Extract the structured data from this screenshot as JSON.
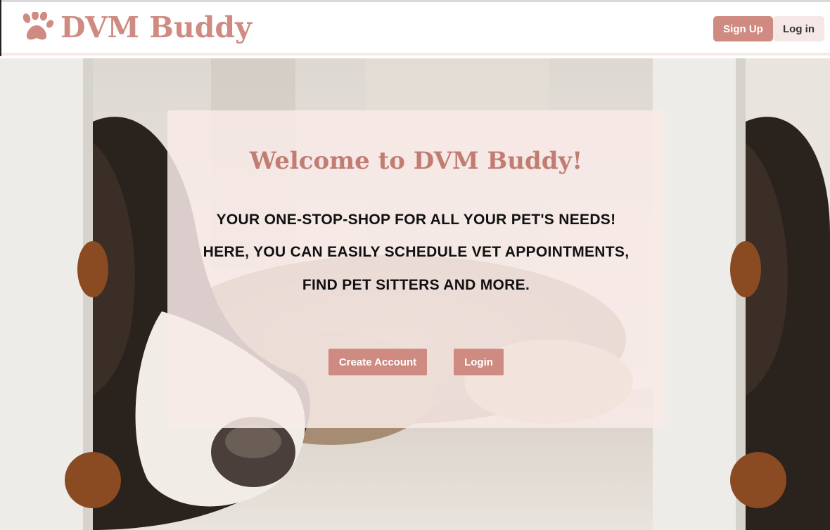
{
  "header": {
    "brand_name": "DVM Buddy",
    "brand_icon": "paw-icon",
    "signup_label": "Sign Up",
    "login_label": "Log in"
  },
  "hero": {
    "background_image": "dog-and-cat-lying-on-floor-photo"
  },
  "card": {
    "title": "Welcome to DVM Buddy!",
    "lines": [
      "YOUR ONE-STOP-SHOP FOR ALL YOUR PET'S NEEDS!",
      "HERE, YOU CAN EASILY SCHEDULE VET APPOINTMENTS,",
      "FIND PET SITTERS AND MORE."
    ],
    "create_account_label": "Create Account",
    "login_label": "Login"
  },
  "colors": {
    "accent": "#cf8b82",
    "title": "#c27d72",
    "card_background": "#f8eae8",
    "secondary_button": "#f5e7e5"
  }
}
